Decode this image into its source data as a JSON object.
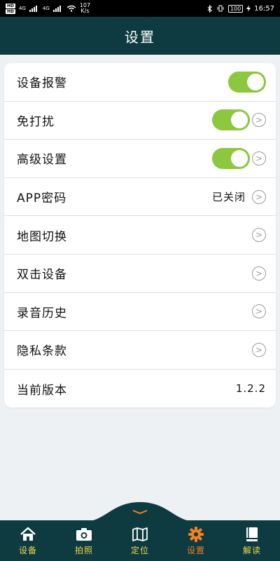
{
  "status_bar": {
    "hd1": "HD",
    "hd2": "HD",
    "net1": "4G",
    "net2": "4G",
    "speed_value": "107",
    "speed_unit": "K/s",
    "battery": "100",
    "time": "16:57"
  },
  "header": {
    "title": "设置"
  },
  "settings": {
    "alarm": {
      "label": "设备报警",
      "enabled": true
    },
    "no_disturb": {
      "label": "免打扰",
      "enabled": true
    },
    "advanced": {
      "label": "高级设置",
      "enabled": true
    },
    "app_password": {
      "label": "APP密码",
      "value": "已关闭"
    },
    "map_switch": {
      "label": "地图切换"
    },
    "double_click": {
      "label": "双击设备"
    },
    "recording": {
      "label": "录音历史"
    },
    "privacy": {
      "label": "隐私条款"
    },
    "version": {
      "label": "当前版本",
      "value": "1.2.2"
    }
  },
  "tabs": [
    {
      "label": "设备",
      "icon": "home-icon"
    },
    {
      "label": "拍照",
      "icon": "camera-icon"
    },
    {
      "label": "定位",
      "icon": "map-icon"
    },
    {
      "label": "设置",
      "icon": "gear-icon",
      "active": true
    },
    {
      "label": "解读",
      "icon": "book-icon"
    }
  ],
  "colors": {
    "header_bg": "#0e3b40",
    "toggle_on": "#8dc63f",
    "tab_label": "#f1d84b",
    "tab_active": "#f47f24"
  }
}
